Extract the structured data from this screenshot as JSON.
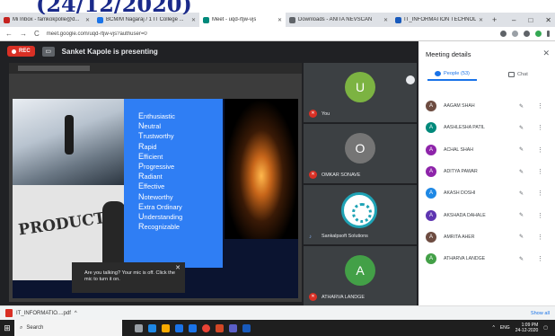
{
  "caption": "(24/12/2020)",
  "browser": {
    "tabs": [
      {
        "label": "Mi Inbox - famkokpolle@d...",
        "color": "#c5221f",
        "active": false
      },
      {
        "label": "BCM/M Nagaraj / 1 IT College ...",
        "color": "#1a73e8",
        "active": false
      },
      {
        "label": "Meet - uqd-rtjw-vjs",
        "color": "#00897b",
        "active": true
      },
      {
        "label": "Downloads - ANITA NEVSCAN",
        "color": "#5f6368",
        "active": false
      },
      {
        "label": "IT_INFORMATION TECHNOLO...",
        "color": "#185abc",
        "active": false
      }
    ],
    "new_tab": "+",
    "controls": [
      "–",
      "□",
      "✕"
    ],
    "url": "meet.google.com/uqd-rtjw-vjs?authuser=0",
    "nav": [
      "←",
      "→",
      "C"
    ]
  },
  "meet": {
    "rec_label": "REC",
    "presenting_text": "Sanket Kapole is presenting",
    "slide": {
      "acrostic": [
        {
          "first": "E",
          "rest": "nthusiastic"
        },
        {
          "first": "N",
          "rest": "eutral"
        },
        {
          "first": "T",
          "rest": "rustworthy"
        },
        {
          "first": "R",
          "rest": "apid"
        },
        {
          "first": "E",
          "rest": "fficient"
        },
        {
          "first": "P",
          "rest": "rogressive"
        },
        {
          "first": "R",
          "rest": "adiant"
        },
        {
          "first": "E",
          "rest": "ffective"
        },
        {
          "first": "N",
          "rest": "oteworthy"
        },
        {
          "first": "E",
          "rest": "xtra Ordinary"
        },
        {
          "first": "U",
          "rest": "nderstanding"
        },
        {
          "first": "R",
          "rest": "ecognizable"
        }
      ],
      "image_word": "PRODUCTIVITY"
    },
    "toast": {
      "text": "Are you talking? Your mic is off. Click the mic to turn it on.",
      "close": "✕"
    },
    "tiles": [
      {
        "avatar": "U",
        "name": "You",
        "color": "#7cb342",
        "muted": true
      },
      {
        "avatar": "O",
        "name": "OMKAR SONAVE",
        "color": "#757575",
        "muted": true
      },
      {
        "avatar": "",
        "name": "Sankalpsoft Solutions",
        "color": "#ffffff",
        "muted": false
      },
      {
        "avatar": "A",
        "name": "ATHARVA LANDGE",
        "color": "#43a047",
        "muted": true
      }
    ]
  },
  "details": {
    "title": "Meeting details",
    "close": "✕",
    "tab_people": "People (53)",
    "tab_chat": "Chat",
    "people": [
      {
        "initial": "A",
        "name": "AAGAM SHAH",
        "color": "#6d4c41"
      },
      {
        "initial": "A",
        "name": "AASHLESHA PATIL",
        "color": "#00897b"
      },
      {
        "initial": "A",
        "name": "ACHAL SHAH",
        "color": "#8e24aa"
      },
      {
        "initial": "A",
        "name": "ADITYA PAWAR",
        "color": "#8e24aa"
      },
      {
        "initial": "A",
        "name": "AKASH DOSHI",
        "color": "#1e88e5"
      },
      {
        "initial": "A",
        "name": "AKSHADA DAHALE",
        "color": "#5e35b1"
      },
      {
        "initial": "A",
        "name": "AMRITA AHER",
        "color": "#6d4c41"
      },
      {
        "initial": "A",
        "name": "ATHARVA LANDGE",
        "color": "#43a047"
      }
    ]
  },
  "downloads": {
    "file": "IT_INFORMATIO....pdf",
    "show_all": "Show all"
  },
  "taskbar": {
    "search_placeholder": "Search",
    "time": "1:09 PM",
    "date": "24-12-2020",
    "lang": "ENG"
  }
}
